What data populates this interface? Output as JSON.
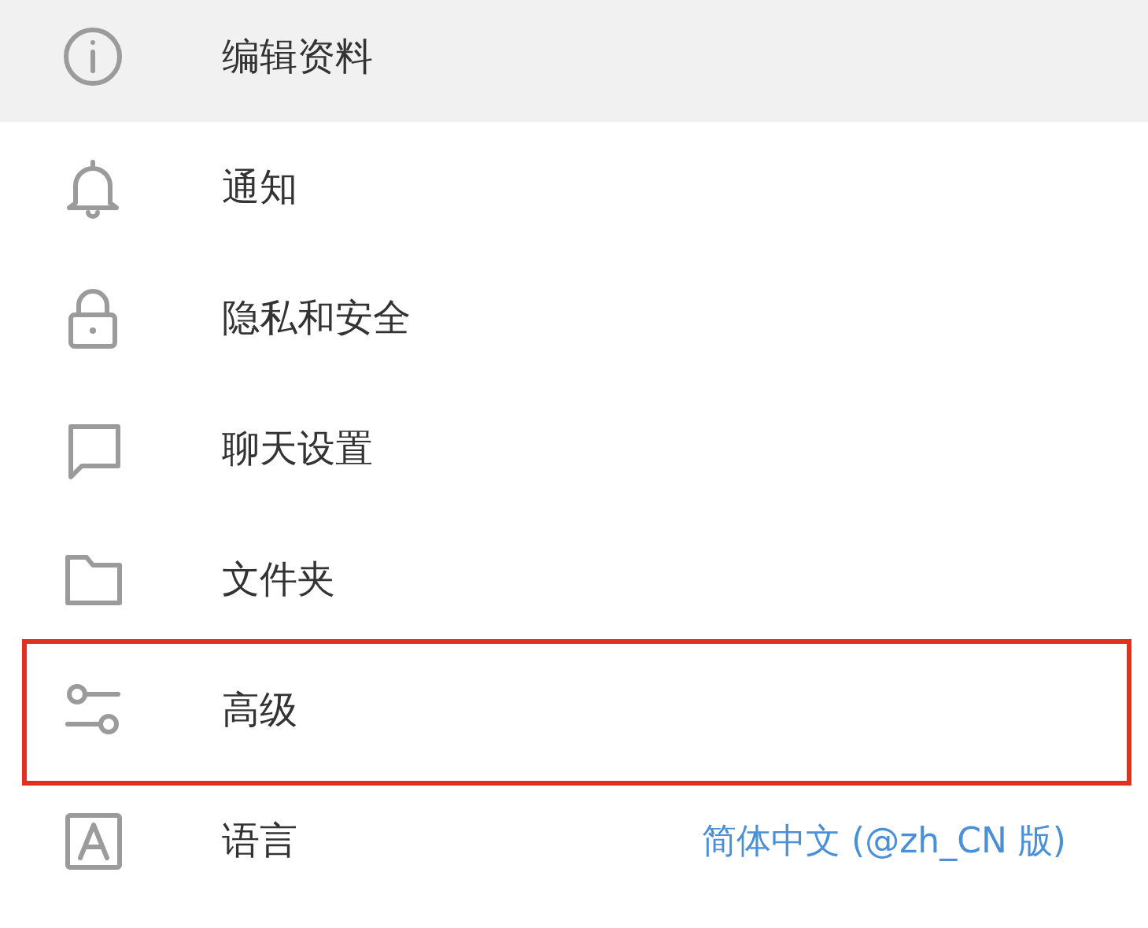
{
  "menu": {
    "items": [
      {
        "label": "编辑资料",
        "selected": true,
        "highlighted": false
      },
      {
        "label": "通知",
        "selected": false,
        "highlighted": false
      },
      {
        "label": "隐私和安全",
        "selected": false,
        "highlighted": false
      },
      {
        "label": "聊天设置",
        "selected": false,
        "highlighted": false
      },
      {
        "label": "文件夹",
        "selected": false,
        "highlighted": false
      },
      {
        "label": "高级",
        "selected": false,
        "highlighted": true
      },
      {
        "label": "语言",
        "selected": false,
        "highlighted": false,
        "value": "简体中文 (@zh_CN 版)"
      }
    ]
  }
}
